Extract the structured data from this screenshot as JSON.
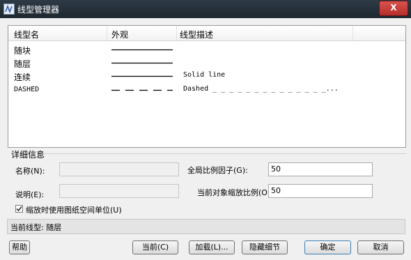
{
  "window": {
    "title": "线型管理器",
    "close_label": "X"
  },
  "list": {
    "headers": [
      "线型名",
      "外观",
      "线型描述"
    ],
    "rows": [
      {
        "name": "随块",
        "appearance": "solid",
        "description": ""
      },
      {
        "name": "随层",
        "appearance": "solid",
        "description": ""
      },
      {
        "name": "连续",
        "appearance": "solid",
        "description": "Solid line"
      },
      {
        "name": "DASHED",
        "appearance": "dashed",
        "description": "Dashed _ _ _ _ _ _ _ _ _ _ _ _ _ _..."
      }
    ]
  },
  "details": {
    "group_title": "详细信息",
    "name_label": "名称(N):",
    "name_value": "",
    "desc_label": "说明(E):",
    "desc_value": "",
    "global_scale_label": "全局比例因子(G):",
    "global_scale_value": "50",
    "current_scale_label": "当前对象缩放比例(O):",
    "current_scale_value": "50",
    "paperspace_label": "缩放时使用图纸空间单位(U)",
    "paperspace_checked": true
  },
  "status": {
    "current_linetype": "当前线型: 随层"
  },
  "buttons": {
    "help": "帮助",
    "current": "当前(C)",
    "load": "加载(L)...",
    "hide_details": "隐藏细节",
    "ok": "确定",
    "cancel": "取消"
  },
  "colors": {
    "titlebar": "#2e3b47",
    "close": "#c9403b",
    "dialog_bg": "#f0f0f0"
  }
}
